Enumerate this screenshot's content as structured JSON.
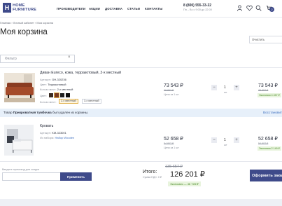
{
  "header": {
    "logo_mark": "H",
    "logo_line1": "HOME",
    "logo_line2": "FURNITURE",
    "nav": [
      "ПРОИЗВОДИТЕЛИ",
      "АКЦИИ",
      "ДОСТАВКА",
      "СТАТЬИ",
      "КОНТАКТЫ"
    ],
    "phone": "8 (800) 555-33-22",
    "hours": "Пн – Вс с 9:00 до 22:00",
    "cart_count": "2",
    "icons": [
      "user-icon",
      "heart-icon",
      "search-icon",
      "cart-icon"
    ]
  },
  "breadcrumb": "Главная › Личный кабинет › Моя корзина",
  "page_title": "Моя корзина",
  "delete_all_label": "Очистить",
  "filter": {
    "placeholder": "Фильтр"
  },
  "items": [
    {
      "name": "Диван Eureco, кожа, терракотовый, 2-х местный",
      "sku_label": "Артикул:",
      "sku": "GH-320236",
      "color_label": "Цвет:",
      "color": "Терракотовый",
      "seats_label": "Кол-во мест:",
      "seats": "2-х местный",
      "color_label2": "Цвет:",
      "swatches": [
        "#3a2a22",
        "#7a3a22",
        "#1f1f1f",
        "#0f0f0f"
      ],
      "seats_label2": "Кол-во мест:",
      "seat_options": [
        "2-х местный",
        "3-х местный"
      ],
      "price": "73 543 ₽",
      "old_price": "78 857 ₽",
      "unit_price": "Цена за 1 шт",
      "qty": "1",
      "qty_unit": "шт",
      "total": "73 543 ₽",
      "total_old": "78 857 ₽",
      "save": "Экономия 4 457 ₽"
    },
    {
      "name": "Кровать",
      "sku_label": "Артикул:",
      "sku": "KM-323001",
      "set_label": "Из набора:",
      "set": "Набор Wooden",
      "price": "52 658 ₽",
      "old_price": "54 807 ₽",
      "unit_price": "Цена за 1 шт",
      "qty": "1",
      "qty_unit": "шт",
      "total": "52 658 ₽",
      "total_old": "54 807 ₽",
      "save": "Экономия 2 149 ₽"
    }
  ],
  "removed_notice": {
    "prefix": "Товар",
    "product": "Прикроватная тумбочка",
    "suffix": "был удален из корзины.",
    "restore": "Восстановить"
  },
  "promo": {
    "label": "Введите промокод для скидки",
    "button": "Применить"
  },
  "summary": {
    "label": "Итого:",
    "old_total": "135 657 ₽",
    "total": "126 201 ₽",
    "vat": "Сумма НДС: 0 ₽",
    "savings": "Экономия — 46 728 ₽",
    "order_button": "Оформить заказ"
  }
}
